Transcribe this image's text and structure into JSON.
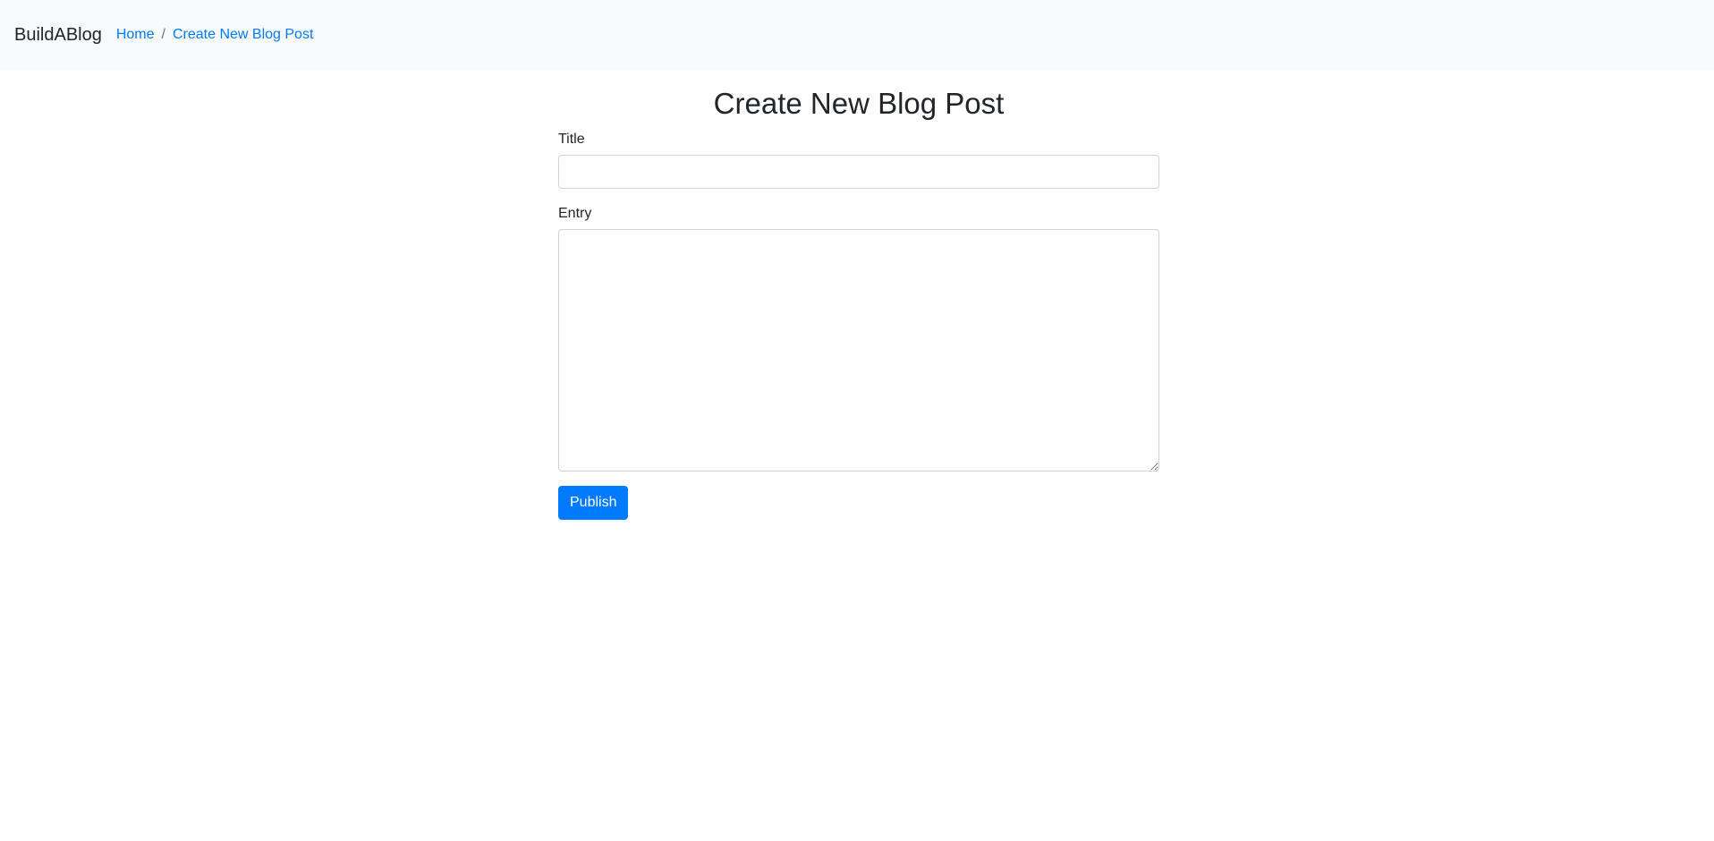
{
  "navbar": {
    "brand": "BuildABlog",
    "breadcrumb": [
      {
        "label": "Home"
      },
      {
        "label": "Create New Blog Post"
      }
    ],
    "separator": "/"
  },
  "main": {
    "heading": "Create New Blog Post",
    "form": {
      "title_label": "Title",
      "title_value": "",
      "entry_label": "Entry",
      "entry_value": "",
      "submit_label": "Publish"
    }
  },
  "colors": {
    "navbar_bg": "#f8f9fa",
    "link": "#007bff",
    "primary_button": "#007bff"
  }
}
